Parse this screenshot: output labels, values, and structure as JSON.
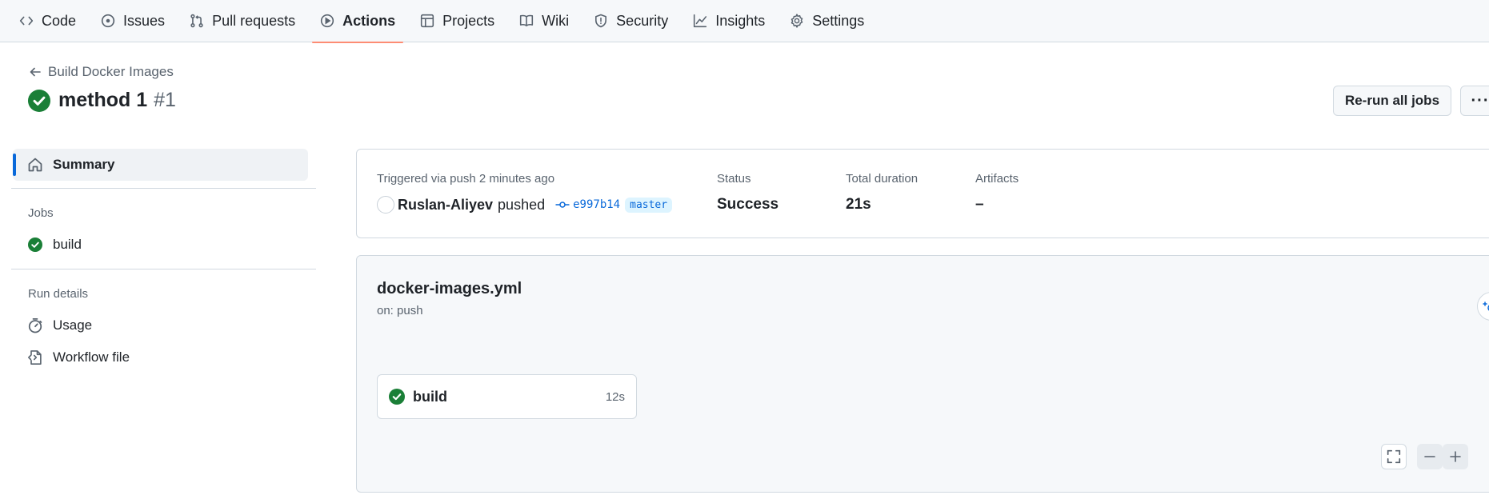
{
  "nav": {
    "tabs": [
      {
        "label": "Code",
        "icon": "code-icon"
      },
      {
        "label": "Issues",
        "icon": "issue-icon"
      },
      {
        "label": "Pull requests",
        "icon": "pull-request-icon"
      },
      {
        "label": "Actions",
        "icon": "play-icon",
        "active": true
      },
      {
        "label": "Projects",
        "icon": "table-icon"
      },
      {
        "label": "Wiki",
        "icon": "book-icon"
      },
      {
        "label": "Security",
        "icon": "shield-icon"
      },
      {
        "label": "Insights",
        "icon": "graph-icon"
      },
      {
        "label": "Settings",
        "icon": "gear-icon"
      }
    ],
    "active_color": "#fd8c73"
  },
  "header": {
    "back_label": "Build Docker Images",
    "run_title": "method 1",
    "run_number": "#1",
    "rerun_label": "Re-run all jobs",
    "more_label": "···"
  },
  "sidebar": {
    "summary_label": "Summary",
    "jobs_heading": "Jobs",
    "jobs": [
      {
        "label": "build",
        "status": "success"
      }
    ],
    "run_details_heading": "Run details",
    "details": [
      {
        "label": "Usage",
        "icon": "stopwatch-icon"
      },
      {
        "label": "Workflow file",
        "icon": "file-code-icon"
      }
    ]
  },
  "summary": {
    "trigger_text": "Triggered via push 2 minutes ago",
    "actor": "Ruslan-Aliyev",
    "action": "pushed",
    "commit": "e997b14",
    "branch": "master",
    "status_label": "Status",
    "status_value": "Success",
    "duration_label": "Total duration",
    "duration_value": "21s",
    "artifacts_label": "Artifacts",
    "artifacts_value": "–"
  },
  "workflow": {
    "file": "docker-images.yml",
    "trigger": "on: push",
    "job_name": "build",
    "job_duration": "12s"
  },
  "colors": {
    "success": "#1a7f37",
    "link": "#0969da",
    "accent_bar": "#0969da"
  }
}
